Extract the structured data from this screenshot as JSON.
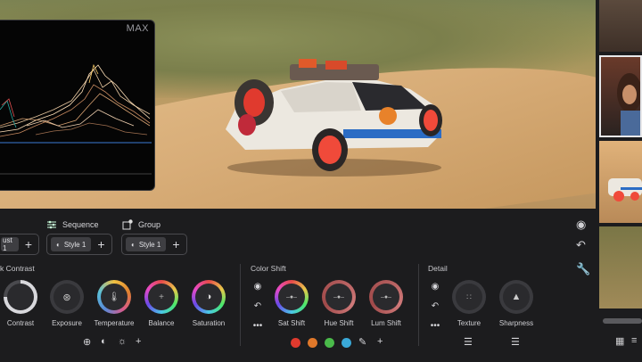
{
  "scope": {
    "max_label": "MAX"
  },
  "tabs": {
    "sequence_label": "Sequence",
    "group_label": "Group"
  },
  "styles": {
    "adjust_chip": "ust 1",
    "sequence_chip": "Style 1",
    "group_chip": "Style 1",
    "plus": "+"
  },
  "sections": {
    "contrast_title": "k Contrast",
    "color_shift_title": "Color Shift",
    "detail_title": "Detail"
  },
  "knobs": {
    "contrast": "Contrast",
    "exposure": "Exposure",
    "temperature": "Temperature",
    "balance": "Balance",
    "saturation": "Saturation",
    "sat_shift": "Sat Shift",
    "hue_shift": "Hue Shift",
    "lum_shift": "Lum Shift",
    "texture": "Texture",
    "sharpness": "Sharpness"
  },
  "swatch_colors": [
    "#e03a2e",
    "#e0782a",
    "#4aba4a",
    "#3aa9d8",
    "#b04ad8"
  ],
  "icons": {
    "eye": "eye-icon",
    "undo": "undo-icon",
    "wrench": "wrench-icon",
    "more": "more-icon"
  }
}
